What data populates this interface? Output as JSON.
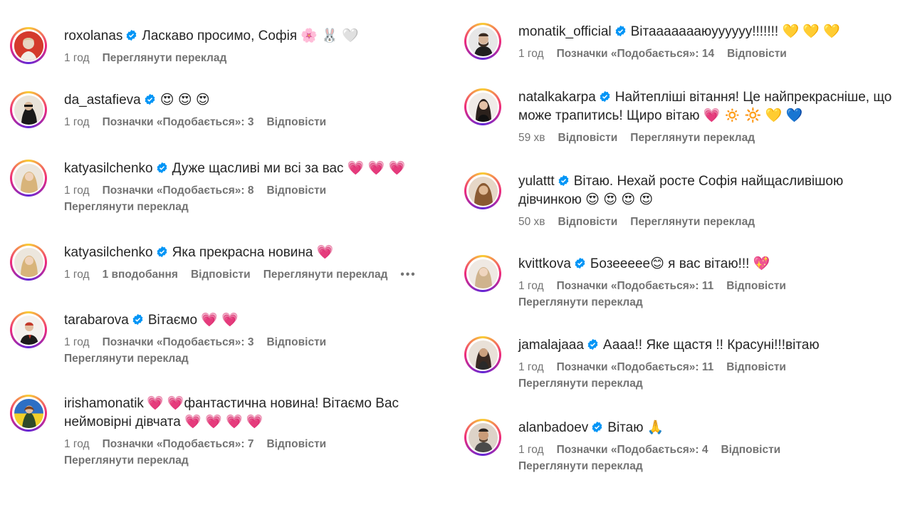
{
  "ui": {
    "reply_label": "Відповісти",
    "translate_label": "Переглянути переклад",
    "more_label": "•••"
  },
  "left": [
    {
      "username": "roxolanas",
      "text": "Ласкаво просимо, Софія 🌸 🐰 🤍",
      "time": "1 год",
      "likes": "",
      "reply": false,
      "translate_inline": "Переглянути переклад",
      "translate_below": ""
    },
    {
      "username": "da_astafieva",
      "text": "😍 😍 😍",
      "time": "1 год",
      "likes": "Позначки «Подобається»: 3",
      "reply": true,
      "translate_inline": "",
      "translate_below": ""
    },
    {
      "username": "katyasilchenko",
      "text": "Дуже щасливі ми всі за вас 💗 💗 💗",
      "time": "1 год",
      "likes": "Позначки «Подобається»: 8",
      "reply": true,
      "translate_inline": "",
      "translate_below": "Переглянути переклад"
    },
    {
      "username": "katyasilchenko",
      "text": "Яка прекрасна новина 💗",
      "time": "1 год",
      "likes": "1 вподобання",
      "reply": true,
      "translate_inline": "Переглянути переклад",
      "translate_below": "",
      "more": true
    },
    {
      "username": "tarabarova",
      "text": "Вітаємо 💗 💗",
      "time": "1 год",
      "likes": "Позначки «Подобається»: 3",
      "reply": true,
      "translate_inline": "",
      "translate_below": "Переглянути переклад"
    },
    {
      "username": "irishamonatik",
      "text": "💗 💗фантастична новина! Вітаємо Вас неймовірні дівчата 💗 💗 💗 💗",
      "time": "1 год",
      "likes": "Позначки «Подобається»: 7",
      "reply": true,
      "translate_inline": "",
      "translate_below": "Переглянути переклад"
    }
  ],
  "right": [
    {
      "username": "monatik_official",
      "text": "Вітаааааааюуууууу!!!!!!! 💛 💛 💛",
      "time": "1 год",
      "likes": "Позначки «Подобається»: 14",
      "reply": true,
      "translate_inline": "",
      "translate_below": ""
    },
    {
      "username": "natalkakarpa",
      "text": "Найтепліші вітання! Це найпрекрасніше, що може трапитись! Щиро вітаю 💗 🔅 🔆 💛 💙",
      "time": "59 хв",
      "likes": "",
      "reply": true,
      "translate_inline": "Переглянути переклад",
      "translate_below": ""
    },
    {
      "username": "yulattt",
      "text": "Вітаю. Нехай росте Софія найщасливішою дівчинкою 😍 😍 😍 😍",
      "time": "50 хв",
      "likes": "",
      "reply": true,
      "translate_inline": "Переглянути переклад",
      "translate_below": ""
    },
    {
      "username": "kvittkova",
      "text": "Бозеееее😊 я вас вітаю!!! 💖",
      "time": "1 год",
      "likes": "Позначки «Подобається»: 11",
      "reply": true,
      "translate_inline": "",
      "translate_below": "Переглянути переклад"
    },
    {
      "username": "jamalajaaa",
      "text": "Аааа!! Яке щастя !! Красуні!!!вітаю",
      "time": "1 год",
      "likes": "Позначки «Подобається»: 11",
      "reply": true,
      "translate_inline": "",
      "translate_below": "Переглянути переклад"
    },
    {
      "username": "alanbadoev",
      "text": "Вітаю 🙏",
      "time": "1 год",
      "likes": "Позначки «Подобається»: 4",
      "reply": true,
      "translate_inline": "",
      "translate_below": "Переглянути переклад"
    }
  ]
}
